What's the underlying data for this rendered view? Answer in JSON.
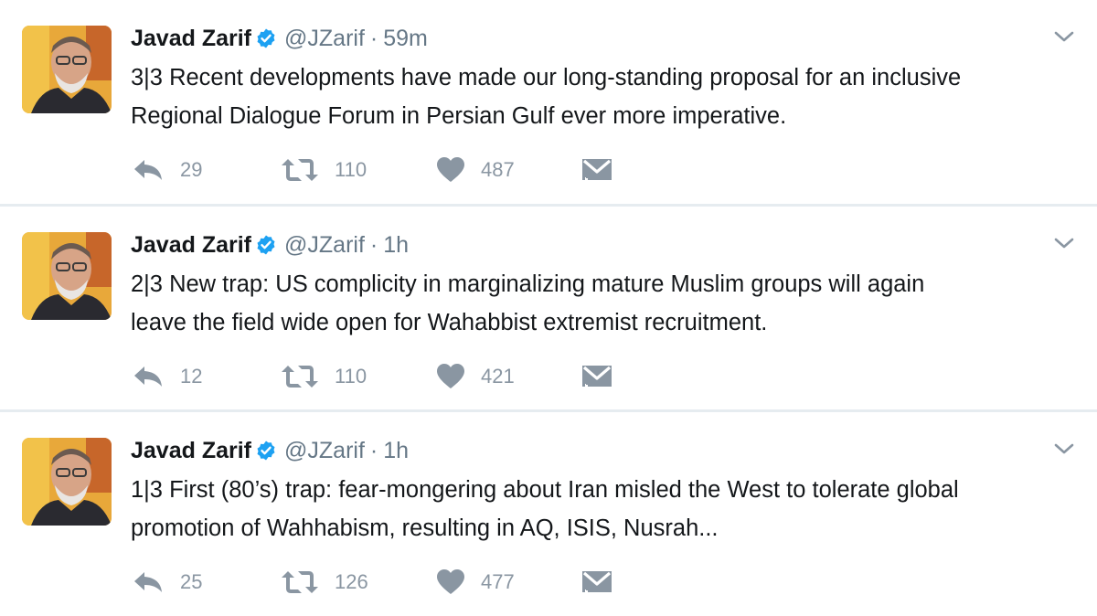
{
  "tweets": [
    {
      "name": "Javad Zarif",
      "handle": "@JZarif",
      "separator": "·",
      "time": "59m",
      "text_lines": [
        "3|3 Recent developments have made our long-standing proposal for an inclusive",
        "Regional Dialogue Forum in Persian Gulf ever more imperative."
      ],
      "replies": "29",
      "retweets": "110",
      "likes": "487"
    },
    {
      "name": "Javad Zarif",
      "handle": "@JZarif",
      "separator": "·",
      "time": "1h",
      "text_lines": [
        "2|3 New trap: US complicity in marginalizing mature Muslim groups will again",
        "leave the field wide open for Wahabbist extremist recruitment."
      ],
      "replies": "12",
      "retweets": "110",
      "likes": "421"
    },
    {
      "name": "Javad Zarif",
      "handle": "@JZarif",
      "separator": "·",
      "time": "1h",
      "text_lines": [
        "1|3 First (80’s) trap: fear-mongering about Iran misled the West to tolerate global",
        "promotion of Wahhabism, resulting in AQ, ISIS, Nusrah..."
      ],
      "replies": "25",
      "retweets": "126",
      "likes": "477"
    }
  ],
  "icons": {
    "verified": "verified-badge-icon",
    "caret": "chevron-down-icon",
    "reply": "reply-icon",
    "retweet": "retweet-icon",
    "like": "heart-icon",
    "dm": "direct-message-icon"
  },
  "colors": {
    "verified_blue": "#1da1f2",
    "action_gray": "#8a96a2",
    "text": "#14171a",
    "secondary": "#657786",
    "separator": "#e6ecf0"
  }
}
